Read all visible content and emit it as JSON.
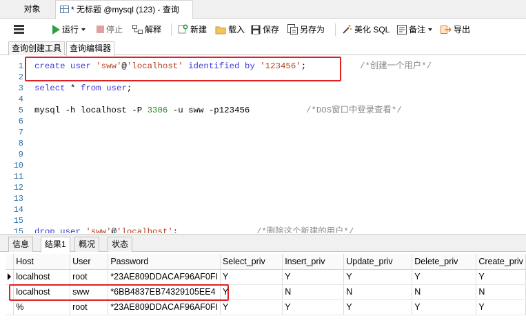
{
  "window_tabs": {
    "objects": "对象",
    "query": "* 无标题 @mysql (123) - 查询"
  },
  "toolbar": {
    "run": "运行",
    "stop": "停止",
    "explain": "解释",
    "new": "新建",
    "load": "载入",
    "save": "保存",
    "save_as": "另存为",
    "beautify": "美化 SQL",
    "comment": "备注",
    "export": "导出"
  },
  "sub_tabs": [
    "查询创建工具",
    "查询编辑器"
  ],
  "editor": {
    "line_numbers": [
      "1",
      "2",
      "3",
      "4",
      "5",
      "6",
      "7",
      "8",
      "9",
      "10",
      "11",
      "12",
      "13",
      "14",
      "15"
    ],
    "line1": {
      "kw1": "create user ",
      "str1": "'sww'",
      "at": "@",
      "str2": "'localhost'",
      "kw2": " identified by ",
      "str3": "'123456'",
      "end": ";",
      "comment": "/*创建一个用户*/"
    },
    "line3": {
      "kw1": "select",
      "mid": " * ",
      "kw2": "from",
      "rest": " ",
      "kw3": "user",
      "end": ";"
    },
    "line5": {
      "p1": "mysql -h localhost -P ",
      "num": "3306",
      "p2": " -u sww -p123456",
      "comment": "/*DOS窗口中登录查看*/"
    },
    "line15": {
      "kw1": "drop user ",
      "str1": "'sww'",
      "at": "@",
      "str2": "'localhost'",
      "end": ";",
      "comment": "/*删除这个新建的用户*/"
    }
  },
  "bottom_tabs": [
    "信息",
    "结果1",
    "概况",
    "状态"
  ],
  "results": {
    "columns": [
      "Host",
      "User",
      "Password",
      "Select_priv",
      "Insert_priv",
      "Update_priv",
      "Delete_priv",
      "Create_priv"
    ],
    "rows": [
      [
        "localhost",
        "root",
        "*23AE809DDACAF96AF0FI",
        "Y",
        "Y",
        "Y",
        "Y",
        "Y"
      ],
      [
        "localhost",
        "sww",
        "*6BB4837EB74329105EE4",
        "Y",
        "N",
        "N",
        "N",
        "N"
      ],
      [
        "%",
        "root",
        "*23AE809DDACAF96AF0FI",
        "Y",
        "Y",
        "Y",
        "Y",
        "Y"
      ]
    ]
  }
}
